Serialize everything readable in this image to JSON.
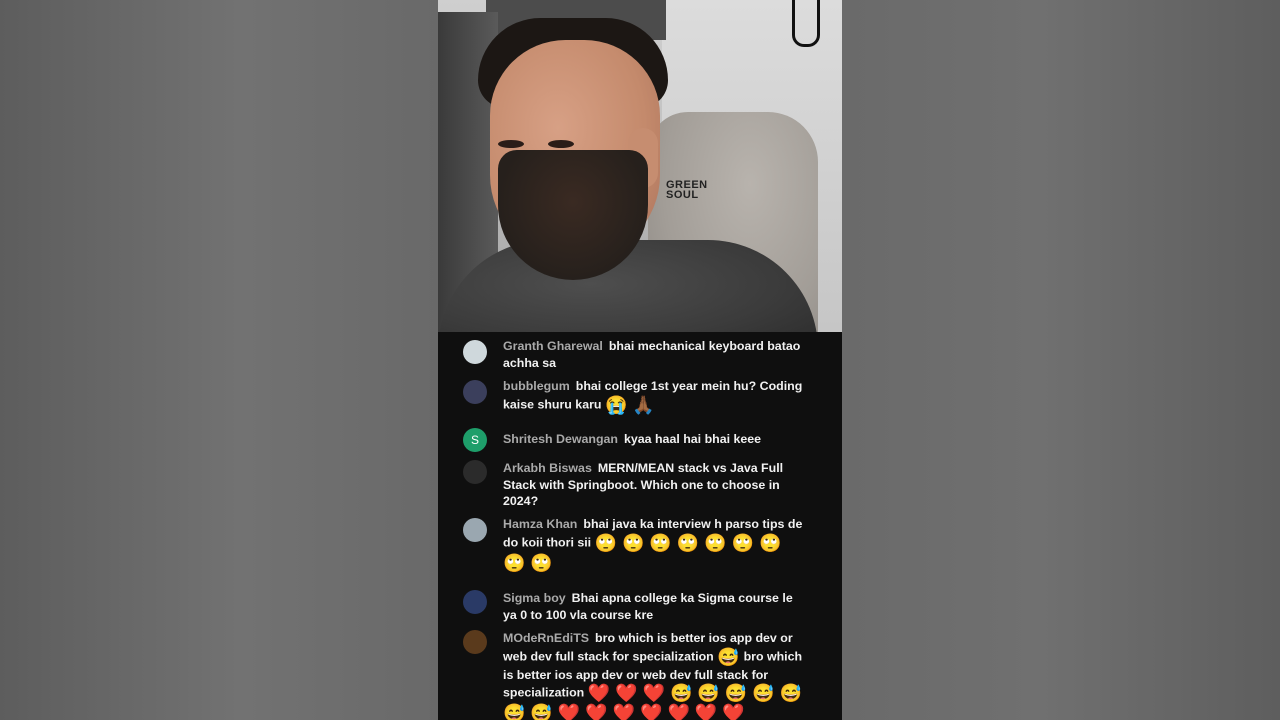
{
  "video": {
    "chair_brand_line1": "GREEN",
    "chair_brand_line2": "SOUL"
  },
  "chat": {
    "messages": [
      {
        "author": "Granth Gharewal",
        "text": "bhai mechanical keyboard batao achha sa",
        "emoji": "",
        "avatar_color": "#cfd8dc",
        "avatar_letter": ""
      },
      {
        "author": "bubblegum",
        "text": "bhai college 1st year mein hu? Coding kaise shuru karu",
        "emoji": "😭 🙏🏾",
        "avatar_color": "#3b3f5c",
        "avatar_letter": ""
      },
      {
        "author": "Shritesh Dewangan",
        "text": "kyaa haal hai bhai keee",
        "emoji": "",
        "avatar_color": "#1e9e6a",
        "avatar_letter": "S"
      },
      {
        "author": "Arkabh Biswas",
        "text": "MERN/MEAN stack vs Java Full Stack with Springboot. Which one to choose in 2024?",
        "emoji": "",
        "avatar_color": "#2b2b2b",
        "avatar_letter": ""
      },
      {
        "author": "Hamza Khan",
        "text": "bhai java ka interview h parso tips de do koii thori sii",
        "emoji": "🙄 🙄 🙄 🙄 🙄 🙄 🙄 🙄 🙄",
        "avatar_color": "#9aa7b0",
        "avatar_letter": ""
      },
      {
        "author": "Sigma boy",
        "text": "Bhai apna college ka Sigma course le ya 0 to 100 vla course kre",
        "emoji": "",
        "avatar_color": "#2a3a66",
        "avatar_letter": ""
      },
      {
        "author": "MOdeRnEdiTS",
        "text": "bro which is better ios app dev or web dev full stack for specialization",
        "emoji": "😅",
        "text2": "bro which is better ios app dev or web dev full stack for specialization",
        "emoji2": "❤️ ❤️ ❤️ 😅 😅 😅 😅 😅 😅 😅 ❤️ ❤️ ❤️ ❤️ ❤️ ❤️ ❤️",
        "avatar_color": "#5a3a1c",
        "avatar_letter": ""
      }
    ]
  }
}
